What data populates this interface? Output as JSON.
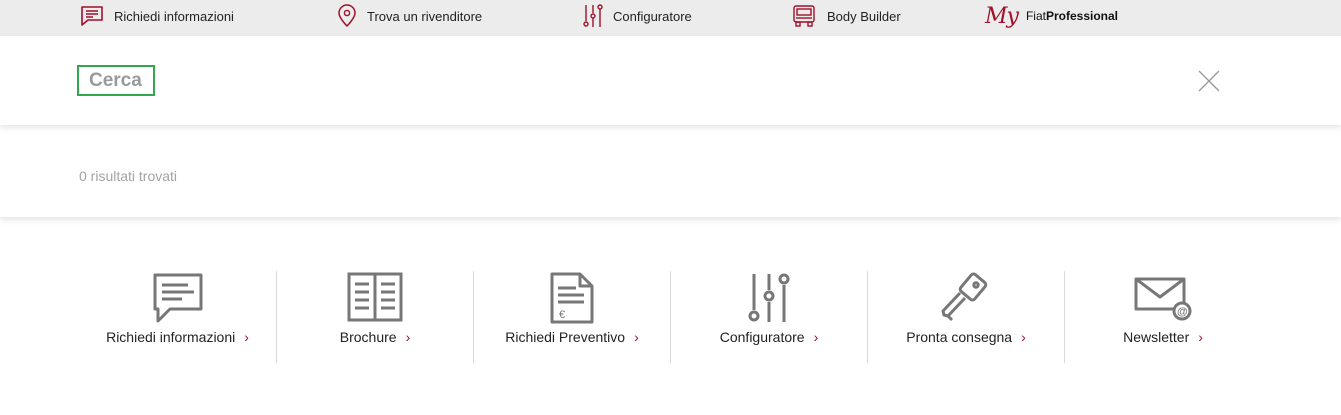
{
  "topbar": {
    "items": [
      {
        "label": "Richiedi informazioni",
        "icon": "chat-icon"
      },
      {
        "label": "Trova un rivenditore",
        "icon": "map-pin-icon"
      },
      {
        "label": "Configuratore",
        "icon": "sliders-icon"
      },
      {
        "label": "Body Builder",
        "icon": "truck-icon"
      }
    ],
    "brand": {
      "my": "My",
      "fiat": "Fiat",
      "professional": "Professional"
    }
  },
  "search": {
    "placeholder": "Cerca",
    "value": ""
  },
  "results": {
    "text": "0 risultati trovati"
  },
  "quick_links": [
    {
      "label": "Richiedi informazioni",
      "icon": "chat-icon"
    },
    {
      "label": "Brochure",
      "icon": "book-icon"
    },
    {
      "label": "Richiedi Preventivo",
      "icon": "document-euro-icon"
    },
    {
      "label": "Configuratore",
      "icon": "sliders-icon"
    },
    {
      "label": "Pronta consegna",
      "icon": "key-icon"
    },
    {
      "label": "Newsletter",
      "icon": "mail-at-icon"
    }
  ],
  "colors": {
    "accent": "#a0102a",
    "focus": "#2fa84f",
    "icons": "#777777"
  }
}
